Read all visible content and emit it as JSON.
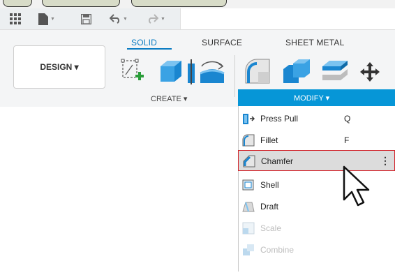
{
  "ribbon": {
    "tabs": [
      "SOLID",
      "SURFACE",
      "SHEET METAL"
    ],
    "design_label": "DESIGN ▾",
    "create_label": "CREATE ▾",
    "modify_label": "MODIFY ▾"
  },
  "menu": {
    "items": [
      {
        "label": "Press Pull",
        "key": "Q"
      },
      {
        "label": "Fillet",
        "key": "F"
      },
      {
        "label": "Chamfer",
        "key": "",
        "more": "⋮"
      },
      {
        "label": "Shell",
        "key": ""
      },
      {
        "label": "Draft",
        "key": ""
      },
      {
        "label": "Scale",
        "key": ""
      },
      {
        "label": "Combine",
        "key": ""
      }
    ]
  },
  "colors": {
    "accent": "#0696d7",
    "tab_active": "#0a7bc2",
    "highlight_border": "#d2232a",
    "highlight_bg": "#dcdcdc"
  },
  "icons": [
    "grid-icon",
    "file-icon",
    "save-icon",
    "undo-icon",
    "redo-icon",
    "sketch-icon",
    "extrude-icon",
    "revolve-icon",
    "fillet-icon",
    "chamfer-icon",
    "shell-icon",
    "move-icon"
  ]
}
